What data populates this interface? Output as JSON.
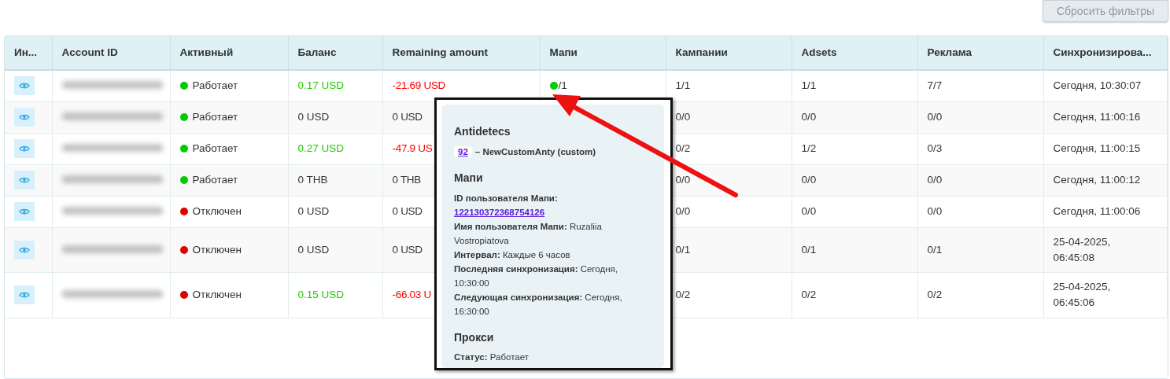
{
  "reset_button": {
    "label": "Сбросить фильтры",
    "disabled": true
  },
  "table": {
    "columns": [
      "Ин...",
      "Account ID",
      "Активный",
      "Баланс",
      "Remaining amount",
      "Мапи",
      "Кампании",
      "Adsets",
      "Реклама",
      "Синхронизирова..."
    ],
    "rows": [
      {
        "status": {
          "text": "Работает",
          "color": "#00cc00"
        },
        "balance": {
          "text": "0.17 USD",
          "color": "#22cc00"
        },
        "remaining": {
          "text": "-21.69 USD",
          "color": "#ff0000"
        },
        "mapi": {
          "color": "#00cc00",
          "text": "/1"
        },
        "campaigns": "1/1",
        "adsets": "1/1",
        "ads": "7/7",
        "synced": "Сегодня, 10:30:07"
      },
      {
        "status": {
          "text": "Работает",
          "color": "#00cc00"
        },
        "balance": {
          "text": "0 USD",
          "color": "#333333"
        },
        "remaining": {
          "text": "0 USD",
          "color": "#333333"
        },
        "campaigns": "0/0",
        "adsets": "0/0",
        "ads": "0/0",
        "synced": "Сегодня, 11:00:16"
      },
      {
        "status": {
          "text": "Работает",
          "color": "#00cc00"
        },
        "balance": {
          "text": "0.27 USD",
          "color": "#22cc00"
        },
        "remaining": {
          "text": "-47.9 US",
          "color": "#ff0000"
        },
        "campaigns": "0/2",
        "adsets": "1/2",
        "ads": "0/3",
        "synced": "Сегодня, 11:00:15"
      },
      {
        "status": {
          "text": "Работает",
          "color": "#00cc00"
        },
        "balance": {
          "text": "0 THB",
          "color": "#333333"
        },
        "remaining": {
          "text": "0 THB",
          "color": "#333333"
        },
        "campaigns": "0/0",
        "adsets": "0/0",
        "ads": "0/0",
        "synced": "Сегодня, 11:00:12"
      },
      {
        "status": {
          "text": "Отключен",
          "color": "#e00000"
        },
        "balance": {
          "text": "0 USD",
          "color": "#333333"
        },
        "remaining": {
          "text": "0 USD",
          "color": "#333333"
        },
        "campaigns": "0/0",
        "adsets": "0/0",
        "ads": "0/0",
        "synced": "Сегодня, 11:00:06"
      },
      {
        "status": {
          "text": "Отключен",
          "color": "#e00000"
        },
        "balance": {
          "text": "0 USD",
          "color": "#333333"
        },
        "remaining": {
          "text": "0 USD",
          "color": "#333333"
        },
        "campaigns": "0/1",
        "adsets": "0/1",
        "ads": "0/1",
        "synced": "25-04-2025, 06:45:08"
      },
      {
        "status": {
          "text": "Отключен",
          "color": "#e00000"
        },
        "balance": {
          "text": "0.15 USD",
          "color": "#22cc00"
        },
        "remaining": {
          "text": "-66.03 U",
          "color": "#ff0000"
        },
        "campaigns": "0/2",
        "adsets": "0/2",
        "ads": "0/2",
        "synced": "25-04-2025, 06:45:06"
      }
    ]
  },
  "tooltip": {
    "sections": [
      {
        "title": "Antidetecs",
        "kind": "antidetect",
        "badge": "92",
        "text": "– NewCustomAnty (custom)"
      },
      {
        "title": "Мапи",
        "kind": "fields",
        "lines": [
          {
            "label": "ID пользователя Мапи:",
            "value": "122130372368754126",
            "link": true
          },
          {
            "label": "Имя пользователя Мапи:",
            "value": "Ruzaliia Vostropiatova",
            "link": false
          },
          {
            "label": "Интервал:",
            "value": "Каждые 6 часов",
            "link": false
          },
          {
            "label": "Последняя синхронизация:",
            "value": "Сегодня, 10:30:00",
            "link": false
          },
          {
            "label": "Следующая синхронизация:",
            "value": "Сегодня, 16:30:00",
            "link": false
          }
        ]
      },
      {
        "title": "Прокси",
        "kind": "fields",
        "lines": [
          {
            "label": "Статус:",
            "value": "Работает",
            "link": false
          }
        ]
      }
    ]
  }
}
